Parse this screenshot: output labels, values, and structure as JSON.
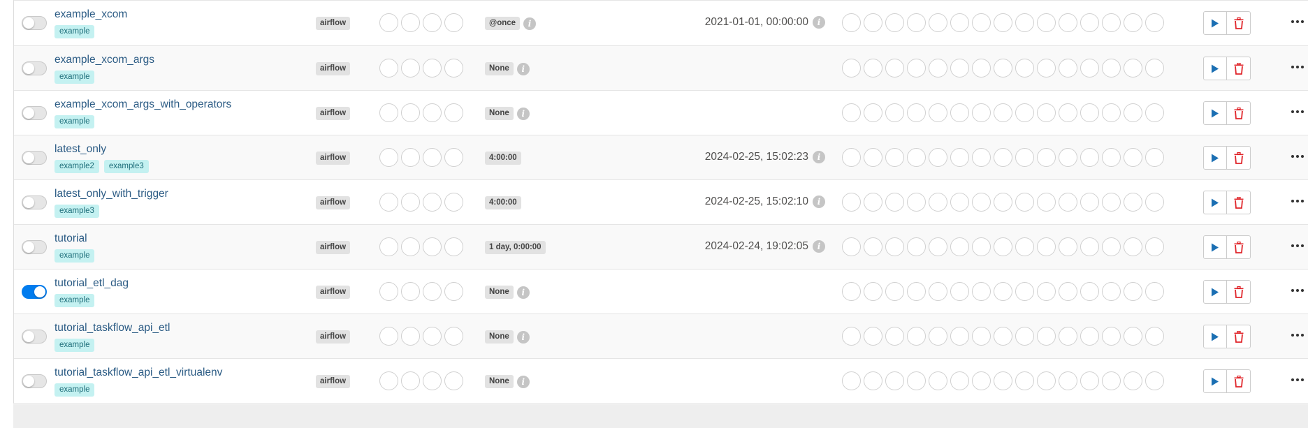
{
  "colors": {
    "accent": "#017cee",
    "link": "#2b5b84",
    "tag_bg": "#c4f1f1",
    "play": "#1b6fb3",
    "delete": "#e0262b"
  },
  "rows": [
    {
      "dag_id": "example_xcom",
      "tags": [
        "example"
      ],
      "owner": "airflow",
      "schedule": "@once",
      "schedule_info": true,
      "last_run": "2021-01-01, 00:00:00",
      "paused": true
    },
    {
      "dag_id": "example_xcom_args",
      "tags": [
        "example"
      ],
      "owner": "airflow",
      "schedule": "None",
      "schedule_info": true,
      "last_run": "",
      "paused": true
    },
    {
      "dag_id": "example_xcom_args_with_operators",
      "tags": [
        "example"
      ],
      "owner": "airflow",
      "schedule": "None",
      "schedule_info": true,
      "last_run": "",
      "paused": true
    },
    {
      "dag_id": "latest_only",
      "tags": [
        "example2",
        "example3"
      ],
      "owner": "airflow",
      "schedule": "4:00:00",
      "schedule_info": false,
      "last_run": "2024-02-25, 15:02:23",
      "paused": true
    },
    {
      "dag_id": "latest_only_with_trigger",
      "tags": [
        "example3"
      ],
      "owner": "airflow",
      "schedule": "4:00:00",
      "schedule_info": false,
      "last_run": "2024-02-25, 15:02:10",
      "paused": true
    },
    {
      "dag_id": "tutorial",
      "tags": [
        "example"
      ],
      "owner": "airflow",
      "schedule": "1 day, 0:00:00",
      "schedule_info": false,
      "last_run": "2024-02-24, 19:02:05",
      "paused": true
    },
    {
      "dag_id": "tutorial_etl_dag",
      "tags": [
        "example"
      ],
      "owner": "airflow",
      "schedule": "None",
      "schedule_info": true,
      "last_run": "",
      "paused": false
    },
    {
      "dag_id": "tutorial_taskflow_api_etl",
      "tags": [
        "example"
      ],
      "owner": "airflow",
      "schedule": "None",
      "schedule_info": true,
      "last_run": "",
      "paused": true
    },
    {
      "dag_id": "tutorial_taskflow_api_etl_virtualenv",
      "tags": [
        "example"
      ],
      "owner": "airflow",
      "schedule": "None",
      "schedule_info": true,
      "last_run": "",
      "paused": true
    }
  ],
  "icons": {
    "info": "info-icon",
    "play": "play-icon",
    "delete": "trash-icon",
    "more": "more-options-icon"
  },
  "info_glyph": "i",
  "runs_circle_count": 4,
  "tasks_circle_count": 15
}
